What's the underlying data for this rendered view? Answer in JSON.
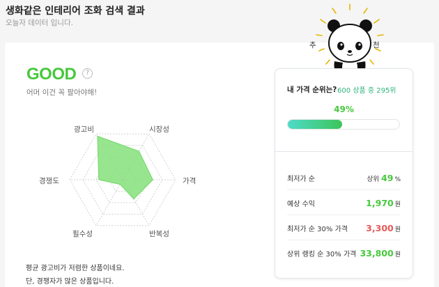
{
  "header": {
    "title": "생화같은 인테리어 조화 검색 결과",
    "subtitle": "오늘자 데이터 입니다."
  },
  "grade": {
    "label": "GOOD",
    "help": "?",
    "comment": "어머 이건 꼭 팔아야해!"
  },
  "radar": {
    "axes": [
      "시장성",
      "가격",
      "반복성",
      "필수성",
      "경쟁도",
      "광고비"
    ],
    "levels": 4,
    "fill_color": "#86e07c",
    "values": [
      0.62,
      0.57,
      0.42,
      0.1,
      0.45,
      0.95
    ]
  },
  "notes": [
    "평균 광고비가 저렴한 상품이네요.",
    "단, 경쟁자가 많은 상품입니다."
  ],
  "recommend": {
    "left": "추",
    "right": "천"
  },
  "rank_panel": {
    "title": "내 가격 순위는?",
    "detail": "600 상품 중 295위",
    "percent_label": "49%",
    "percent_value": 0.49,
    "rows": [
      {
        "label": "최저가 순",
        "prefix": "상위",
        "value": "49",
        "unit": "%",
        "color": "green"
      },
      {
        "label": "예상 수익",
        "prefix": "",
        "value": "1,970",
        "unit": "원",
        "color": "green"
      },
      {
        "label": "최저가 순 30% 가격",
        "prefix": "",
        "value": "3,300",
        "unit": "원",
        "color": "red"
      },
      {
        "label": "상위 랭킹 순 30% 가격",
        "prefix": "",
        "value": "33,800",
        "unit": "원",
        "color": "green"
      }
    ]
  },
  "colors": {
    "accent_green": "#47c83e",
    "red": "#e65a5a",
    "bar_start": "#4ddbc8",
    "bar_end": "#3dc45a"
  }
}
